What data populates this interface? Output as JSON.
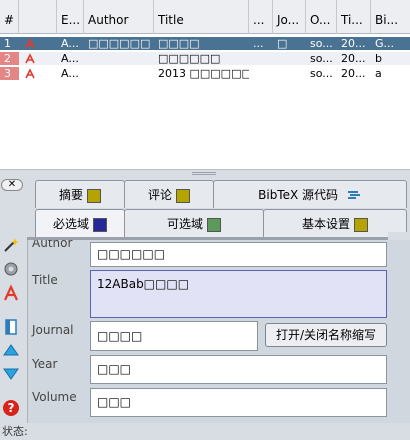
{
  "table": {
    "columns": [
      "#",
      "",
      "E...",
      "Author",
      "Title",
      "...",
      "Jo...",
      "O...",
      "Ti...",
      "Bi..."
    ],
    "rows": [
      {
        "num": "1",
        "e": "A...",
        "author": "□□□□□□",
        "title": "□□□□",
        "dots": "...",
        "jo": "□",
        "o": "so...",
        "ti": "20...",
        "bi": "G..."
      },
      {
        "num": "2",
        "e": "A...",
        "author": "",
        "title": "□□□□□□",
        "dots": "",
        "jo": "",
        "o": "so...",
        "ti": "20...",
        "bi": "b"
      },
      {
        "num": "3",
        "e": "A...",
        "author": "",
        "title": "2013 □□□□□□...",
        "dots": "",
        "jo": "",
        "o": "so...",
        "ti": "20...",
        "bi": "a"
      }
    ]
  },
  "close_label": "✕",
  "tabs_top": {
    "abstract": "摘要",
    "review": "评论",
    "bibtex": "BibTeX 源代码"
  },
  "tabs_bottom": {
    "required": "必选域",
    "optional": "可选域",
    "general": "基本设置"
  },
  "colors": {
    "abstract": "#b5a300",
    "review": "#b5a300",
    "required": "#27279a",
    "optional": "#5c9a5c",
    "general": "#b5a300"
  },
  "form": {
    "author_label": "Author",
    "author_value": "□□□□□□",
    "title_label": "Title",
    "title_value": "12ABab□□□□",
    "journal_label": "Journal",
    "journal_value": "□□□□",
    "abbr_button": "打开/关闭名称缩写",
    "year_label": "Year",
    "year_value": "□□□",
    "volume_label": "Volume",
    "volume_value": "□□□"
  },
  "status": "状态:"
}
